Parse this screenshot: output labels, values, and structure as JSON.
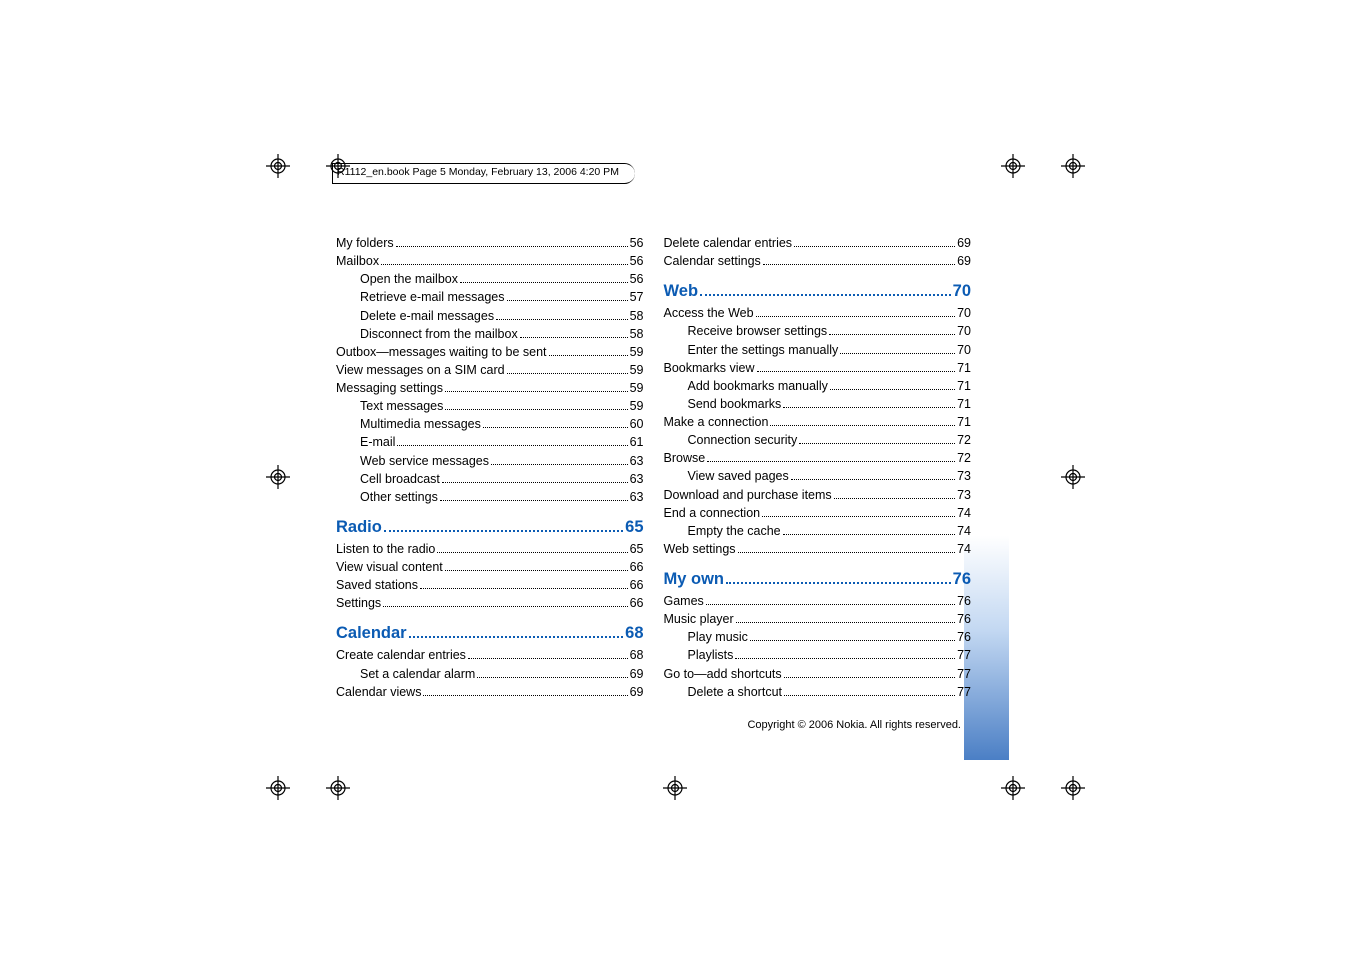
{
  "doc_header": "R1112_en.book  Page 5  Monday, February 13, 2006  4:20 PM",
  "copyright": "Copyright © 2006 Nokia. All rights reserved.",
  "columns": {
    "left": [
      {
        "type": "entry",
        "level": 0,
        "label": "My folders ",
        "page": "56"
      },
      {
        "type": "entry",
        "level": 0,
        "label": "Mailbox",
        "page": "56"
      },
      {
        "type": "entry",
        "level": 1,
        "label": "Open the mailbox",
        "page": "56"
      },
      {
        "type": "entry",
        "level": 1,
        "label": "Retrieve e-mail messages",
        "page": "57"
      },
      {
        "type": "entry",
        "level": 1,
        "label": "Delete e-mail messages",
        "page": "58"
      },
      {
        "type": "entry",
        "level": 1,
        "label": "Disconnect from the mailbox",
        "page": "58"
      },
      {
        "type": "entry",
        "level": 0,
        "label": "Outbox—messages waiting to be sent",
        "page": "59"
      },
      {
        "type": "entry",
        "level": 0,
        "label": "View messages on a SIM card ",
        "page": "59"
      },
      {
        "type": "entry",
        "level": 0,
        "label": "Messaging settings",
        "page": "59"
      },
      {
        "type": "entry",
        "level": 1,
        "label": "Text messages",
        "page": "59"
      },
      {
        "type": "entry",
        "level": 1,
        "label": "Multimedia messages",
        "page": "60"
      },
      {
        "type": "entry",
        "level": 1,
        "label": "E-mail",
        "page": "61"
      },
      {
        "type": "entry",
        "level": 1,
        "label": "Web service messages",
        "page": "63"
      },
      {
        "type": "entry",
        "level": 1,
        "label": "Cell broadcast",
        "page": "63"
      },
      {
        "type": "entry",
        "level": 1,
        "label": "Other settings",
        "page": "63"
      },
      {
        "type": "section",
        "label": "Radio",
        "page": " 65"
      },
      {
        "type": "entry",
        "level": 0,
        "label": "Listen to the radio",
        "page": "65"
      },
      {
        "type": "entry",
        "level": 0,
        "label": "View visual content",
        "page": "66"
      },
      {
        "type": "entry",
        "level": 0,
        "label": "Saved stations",
        "page": "66"
      },
      {
        "type": "entry",
        "level": 0,
        "label": "Settings",
        "page": "66"
      },
      {
        "type": "section",
        "label": "Calendar",
        "page": " 68"
      },
      {
        "type": "entry",
        "level": 0,
        "label": "Create calendar entries",
        "page": "68"
      },
      {
        "type": "entry",
        "level": 1,
        "label": "Set a calendar alarm",
        "page": "69"
      },
      {
        "type": "entry",
        "level": 0,
        "label": "Calendar views",
        "page": "69"
      }
    ],
    "right": [
      {
        "type": "entry",
        "level": 0,
        "label": "Delete calendar entries",
        "page": " 69"
      },
      {
        "type": "entry",
        "level": 0,
        "label": "Calendar settings",
        "page": " 69"
      },
      {
        "type": "section",
        "label": "Web",
        "page": "70"
      },
      {
        "type": "entry",
        "level": 0,
        "label": "Access the Web",
        "page": " 70"
      },
      {
        "type": "entry",
        "level": 1,
        "label": "Receive browser settings",
        "page": " 70"
      },
      {
        "type": "entry",
        "level": 1,
        "label": "Enter the settings manually",
        "page": " 70"
      },
      {
        "type": "entry",
        "level": 0,
        "label": "Bookmarks view",
        "page": " 71"
      },
      {
        "type": "entry",
        "level": 1,
        "label": "Add bookmarks manually",
        "page": " 71"
      },
      {
        "type": "entry",
        "level": 1,
        "label": "Send bookmarks",
        "page": " 71"
      },
      {
        "type": "entry",
        "level": 0,
        "label": "Make a connection",
        "page": " 71"
      },
      {
        "type": "entry",
        "level": 1,
        "label": "Connection security",
        "page": " 72"
      },
      {
        "type": "entry",
        "level": 0,
        "label": "Browse",
        "page": " 72"
      },
      {
        "type": "entry",
        "level": 1,
        "label": "View saved pages",
        "page": " 73"
      },
      {
        "type": "entry",
        "level": 0,
        "label": "Download and purchase items",
        "page": " 73"
      },
      {
        "type": "entry",
        "level": 0,
        "label": "End a connection",
        "page": " 74"
      },
      {
        "type": "entry",
        "level": 1,
        "label": "Empty the cache",
        "page": " 74"
      },
      {
        "type": "entry",
        "level": 0,
        "label": "Web settings",
        "page": " 74"
      },
      {
        "type": "section",
        "label": "My own",
        "page": "76"
      },
      {
        "type": "entry",
        "level": 0,
        "label": "Games",
        "page": " 76"
      },
      {
        "type": "entry",
        "level": 0,
        "label": "Music player",
        "page": " 76"
      },
      {
        "type": "entry",
        "level": 1,
        "label": "Play music",
        "page": " 76"
      },
      {
        "type": "entry",
        "level": 1,
        "label": "Playlists",
        "page": " 77"
      },
      {
        "type": "entry",
        "level": 0,
        "label": "Go to—add shortcuts",
        "page": " 77"
      },
      {
        "type": "entry",
        "level": 1,
        "label": "Delete a shortcut",
        "page": " 77"
      }
    ]
  }
}
